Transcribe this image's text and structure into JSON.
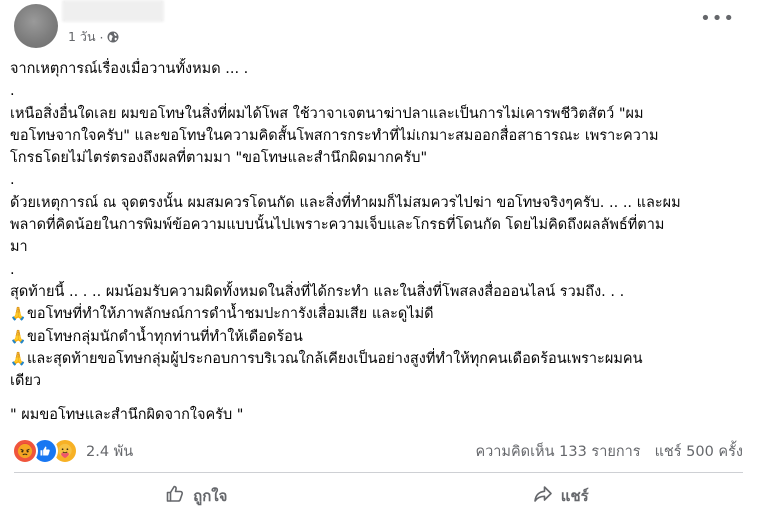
{
  "post": {
    "time": "1 วัน",
    "separator": "·",
    "more_icon": "more-horizontal-icon",
    "privacy_icon": "globe-icon",
    "lines": [
      "จากเหตุการณ์เรื่องเมื่อวานทั้งหมด ... .",
      ".",
      "เหนือสิ่งอื่นใดเลย ผมขอโทษในสิ่งที่ผมได้โพส ใช้วาจาเจตนาฆ่าปลาและเป็นการไม่เคารพชีวิตสัตว์ \"ผม",
      "ขอโทษจากใจครับ\" และขอโทษในความคิดสั้นโพสการกระทำที่ไม่เกมาะสมออกสื่อสาธารณะ เพราะความ",
      "โกรธโดยไม่ไตร่ตรองถึงผลที่ตามมา \"ขอโทษและสำนึกผิดมากครับ\"",
      ".",
      "ด้วยเหตุการณ์ ณ จุดตรงนั้น ผมสมควรโดนกัด และสิ่งที่ทำผมก็ไม่สมควรไปฆ่า ขอโทษจริงๆครับ. .. .. และผม",
      "พลาดที่คิดน้อยในการพิมพ์ข้อความแบบนั้นไปเพราะความเจ็บและโกรธที่โดนกัด โดยไม่คิดถึงผลลัพธ์ที่ตาม",
      "มา",
      ".",
      "สุดท้ายนี้ .. . .. ผมน้อมรับความผิดทั้งหมดในสิ่งที่ได้กระทำ และในสิ่งที่โพสลงสื่อออนไลน์ รวมถึง. . ."
    ],
    "apology_items": [
      "ขอโทษที่ทำให้ภาพลักษณ์การดำน้ำชมปะการังเสื่อมเสีย และดูไม่ดี",
      "ขอโทษกลุ่มนักดำน้ำทุกท่านที่ทำให้เดือดร้อน",
      "และสุดท้ายขอโทษกลุ่มผู้ประกอบการบริเวณใกล้เคียงเป็นอย่างสูงที่ทำให้ทุกคนเดือดร้อนเพราะผมคน"
    ],
    "apology_item_continuation": "เดียว",
    "closing": "\" ผมขอโทษและสำนึกผิดจากใจครับ \"",
    "pray_emoji": "🙏"
  },
  "footer": {
    "reaction_count": "2.4 พัน",
    "reactions": [
      "angry-reaction-icon",
      "like-reaction-icon",
      "care-reaction-icon"
    ],
    "comments": "ความคิดเห็น 133 รายการ",
    "shares": "แชร์ 500 ครั้ง",
    "like_label": "ถูกใจ",
    "share_label": "แชร์",
    "colors": {
      "like_blue": "#1877f2",
      "angry_orange": "#f0553c",
      "care_yellow": "#f7b125",
      "secondary_text": "#65676b"
    }
  }
}
